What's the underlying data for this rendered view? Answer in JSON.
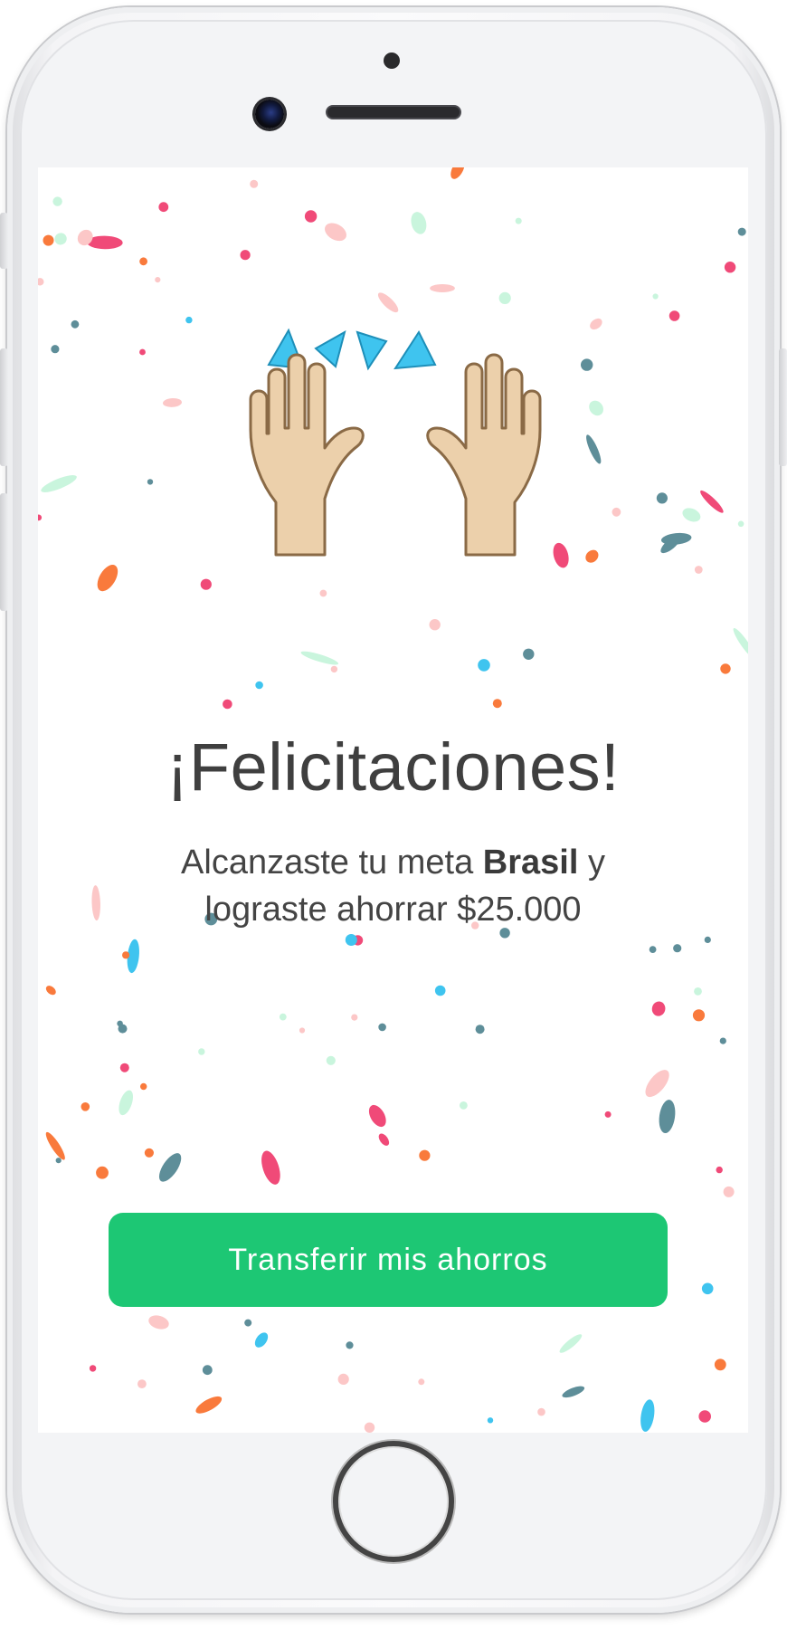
{
  "screen": {
    "title": "¡Felicitaciones!",
    "message_prefix": "Alcanzaste tu meta ",
    "goal_name": "Brasil",
    "message_suffix": " y",
    "message_line2": "lograste ahorrar $25.000",
    "cta_label": "Transferir mis ahorros"
  },
  "colors": {
    "accent": "#1dc774",
    "title_text": "#3f3f3f",
    "confetti": [
      "#f04a78",
      "#f97a3c",
      "#5e8e99",
      "#fcc7c7",
      "#c9f5dd",
      "#3fc4ef"
    ]
  },
  "icons": {
    "hero": "raised-hands-emoji"
  }
}
